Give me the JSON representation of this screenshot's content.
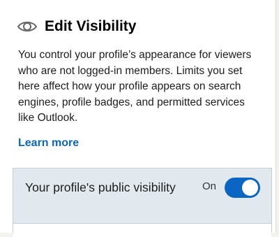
{
  "panel": {
    "title": "Edit Visibility",
    "title_icon": "eye-icon",
    "description": "You control your profile’s appearance for viewers who are not logged-in members. Limits you set here affect how your profile appears on search engines, profile badges, and permitted services like Outlook.",
    "learn_more": "Learn more"
  },
  "visibility_setting": {
    "label": "Your profile's public visibility",
    "state_label": "On",
    "enabled": true
  },
  "colors": {
    "accent": "#0a66c2",
    "setting_background": "#e1e9ee"
  }
}
